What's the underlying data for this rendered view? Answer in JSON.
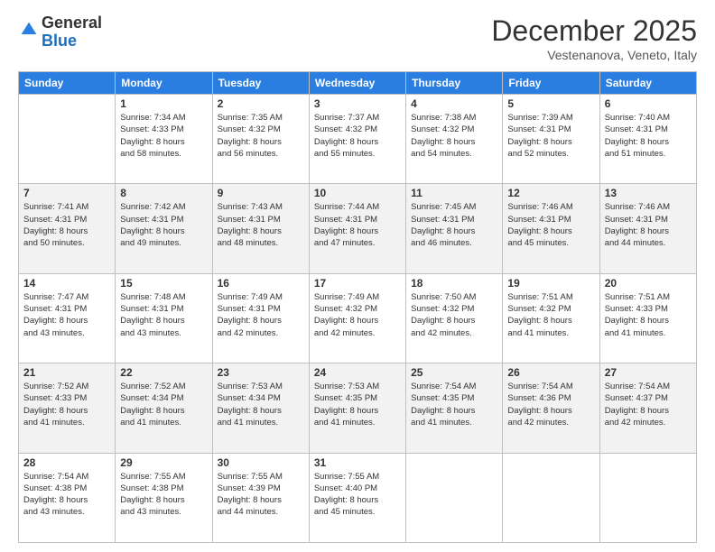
{
  "header": {
    "logo_line1": "General",
    "logo_line2": "Blue",
    "month_title": "December 2025",
    "location": "Vestenanova, Veneto, Italy"
  },
  "days_of_week": [
    "Sunday",
    "Monday",
    "Tuesday",
    "Wednesday",
    "Thursday",
    "Friday",
    "Saturday"
  ],
  "weeks": [
    [
      {
        "day": "",
        "info": ""
      },
      {
        "day": "1",
        "info": "Sunrise: 7:34 AM\nSunset: 4:33 PM\nDaylight: 8 hours\nand 58 minutes."
      },
      {
        "day": "2",
        "info": "Sunrise: 7:35 AM\nSunset: 4:32 PM\nDaylight: 8 hours\nand 56 minutes."
      },
      {
        "day": "3",
        "info": "Sunrise: 7:37 AM\nSunset: 4:32 PM\nDaylight: 8 hours\nand 55 minutes."
      },
      {
        "day": "4",
        "info": "Sunrise: 7:38 AM\nSunset: 4:32 PM\nDaylight: 8 hours\nand 54 minutes."
      },
      {
        "day": "5",
        "info": "Sunrise: 7:39 AM\nSunset: 4:31 PM\nDaylight: 8 hours\nand 52 minutes."
      },
      {
        "day": "6",
        "info": "Sunrise: 7:40 AM\nSunset: 4:31 PM\nDaylight: 8 hours\nand 51 minutes."
      }
    ],
    [
      {
        "day": "7",
        "info": "Sunrise: 7:41 AM\nSunset: 4:31 PM\nDaylight: 8 hours\nand 50 minutes."
      },
      {
        "day": "8",
        "info": "Sunrise: 7:42 AM\nSunset: 4:31 PM\nDaylight: 8 hours\nand 49 minutes."
      },
      {
        "day": "9",
        "info": "Sunrise: 7:43 AM\nSunset: 4:31 PM\nDaylight: 8 hours\nand 48 minutes."
      },
      {
        "day": "10",
        "info": "Sunrise: 7:44 AM\nSunset: 4:31 PM\nDaylight: 8 hours\nand 47 minutes."
      },
      {
        "day": "11",
        "info": "Sunrise: 7:45 AM\nSunset: 4:31 PM\nDaylight: 8 hours\nand 46 minutes."
      },
      {
        "day": "12",
        "info": "Sunrise: 7:46 AM\nSunset: 4:31 PM\nDaylight: 8 hours\nand 45 minutes."
      },
      {
        "day": "13",
        "info": "Sunrise: 7:46 AM\nSunset: 4:31 PM\nDaylight: 8 hours\nand 44 minutes."
      }
    ],
    [
      {
        "day": "14",
        "info": "Sunrise: 7:47 AM\nSunset: 4:31 PM\nDaylight: 8 hours\nand 43 minutes."
      },
      {
        "day": "15",
        "info": "Sunrise: 7:48 AM\nSunset: 4:31 PM\nDaylight: 8 hours\nand 43 minutes."
      },
      {
        "day": "16",
        "info": "Sunrise: 7:49 AM\nSunset: 4:31 PM\nDaylight: 8 hours\nand 42 minutes."
      },
      {
        "day": "17",
        "info": "Sunrise: 7:49 AM\nSunset: 4:32 PM\nDaylight: 8 hours\nand 42 minutes."
      },
      {
        "day": "18",
        "info": "Sunrise: 7:50 AM\nSunset: 4:32 PM\nDaylight: 8 hours\nand 42 minutes."
      },
      {
        "day": "19",
        "info": "Sunrise: 7:51 AM\nSunset: 4:32 PM\nDaylight: 8 hours\nand 41 minutes."
      },
      {
        "day": "20",
        "info": "Sunrise: 7:51 AM\nSunset: 4:33 PM\nDaylight: 8 hours\nand 41 minutes."
      }
    ],
    [
      {
        "day": "21",
        "info": "Sunrise: 7:52 AM\nSunset: 4:33 PM\nDaylight: 8 hours\nand 41 minutes."
      },
      {
        "day": "22",
        "info": "Sunrise: 7:52 AM\nSunset: 4:34 PM\nDaylight: 8 hours\nand 41 minutes."
      },
      {
        "day": "23",
        "info": "Sunrise: 7:53 AM\nSunset: 4:34 PM\nDaylight: 8 hours\nand 41 minutes."
      },
      {
        "day": "24",
        "info": "Sunrise: 7:53 AM\nSunset: 4:35 PM\nDaylight: 8 hours\nand 41 minutes."
      },
      {
        "day": "25",
        "info": "Sunrise: 7:54 AM\nSunset: 4:35 PM\nDaylight: 8 hours\nand 41 minutes."
      },
      {
        "day": "26",
        "info": "Sunrise: 7:54 AM\nSunset: 4:36 PM\nDaylight: 8 hours\nand 42 minutes."
      },
      {
        "day": "27",
        "info": "Sunrise: 7:54 AM\nSunset: 4:37 PM\nDaylight: 8 hours\nand 42 minutes."
      }
    ],
    [
      {
        "day": "28",
        "info": "Sunrise: 7:54 AM\nSunset: 4:38 PM\nDaylight: 8 hours\nand 43 minutes."
      },
      {
        "day": "29",
        "info": "Sunrise: 7:55 AM\nSunset: 4:38 PM\nDaylight: 8 hours\nand 43 minutes."
      },
      {
        "day": "30",
        "info": "Sunrise: 7:55 AM\nSunset: 4:39 PM\nDaylight: 8 hours\nand 44 minutes."
      },
      {
        "day": "31",
        "info": "Sunrise: 7:55 AM\nSunset: 4:40 PM\nDaylight: 8 hours\nand 45 minutes."
      },
      {
        "day": "",
        "info": ""
      },
      {
        "day": "",
        "info": ""
      },
      {
        "day": "",
        "info": ""
      }
    ]
  ]
}
